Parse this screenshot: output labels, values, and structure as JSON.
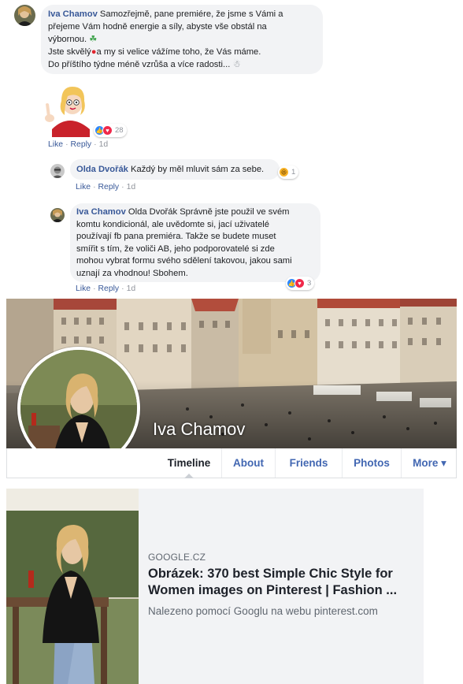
{
  "comments": [
    {
      "author": "Iva Chamov",
      "lines": [
        "Samozřejmě, pane premiére, že jsme s Vámi a",
        "přejeme Vám hodně energie a síly, abyste vše obstál na",
        "výbornou.",
        "Jste skvělý",
        "a my si velice vážíme toho, že Vás máme.",
        "Do příštího týdne méně vzrůša a více radosti..."
      ],
      "sticker_reactions_count": "28",
      "like_label": "Like",
      "reply_label": "Reply",
      "time": "1d"
    }
  ],
  "replies": [
    {
      "author": "Olda Dvořák",
      "text": "Každý by měl mluvit sám za sebe.",
      "reactions_count": "1",
      "like_label": "Like",
      "reply_label": "Reply",
      "time": "1d"
    },
    {
      "author": "Iva Chamov",
      "lines": [
        "Olda Dvořák Správně jste použil ve svém",
        "komtu kondicionál, ale uvědomte si, jací uživatelé",
        "používají fb pana premiéra. Takže se budete muset",
        "smířit s tím, že voliči AB, jeho podporovatelé si zde",
        "mohou vybrat formu svého sdělení takovou, jakou sami",
        "uznají za vhodnou! Sbohem."
      ],
      "reactions_count": "3",
      "like_label": "Like",
      "reply_label": "Reply",
      "time": "1d"
    }
  ],
  "profile": {
    "name": "Iva Chamov",
    "tabs": [
      "Timeline",
      "About",
      "Friends",
      "Photos",
      "More ▾"
    ]
  },
  "link_card": {
    "domain": "GOOGLE.CZ",
    "title": "Obrázek: 370 best Simple Chic Style for Women images on Pinterest | Fashion ...",
    "source": "Nalezeno pomocí Googlu na webu pinterest.com"
  },
  "colors": {
    "link": "#385898",
    "bubble": "#f2f3f5",
    "tab_blue": "#4267b2"
  }
}
